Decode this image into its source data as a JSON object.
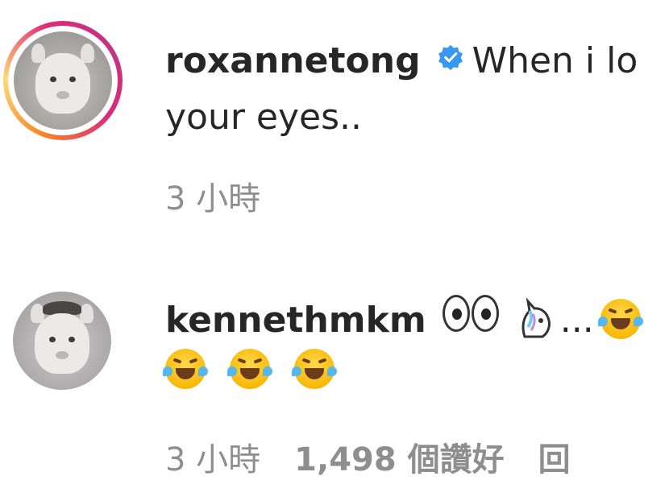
{
  "comments": [
    {
      "username": "roxannetong",
      "verified": true,
      "text_line1": "When i lo",
      "text_line2": "your eyes..",
      "time": "3 小時",
      "avatar_ring": true
    },
    {
      "username": "kennethmkm",
      "verified": false,
      "ellipsis": "...",
      "time": "3 小時",
      "likes": "1,498 個讚好",
      "reply": "回",
      "avatar_ring": false
    }
  ],
  "icons": {
    "verified": "verified-badge-icon",
    "eyes": "eyes-emoji-icon",
    "unicorn": "unicorn-emoji-icon",
    "laugh": "rolling-laughing-emoji-icon",
    "joy": "tears-of-joy-emoji-icon"
  },
  "colors": {
    "verified_blue": "#3897f0",
    "meta_gray": "#8e8e8e",
    "text": "#262626"
  }
}
